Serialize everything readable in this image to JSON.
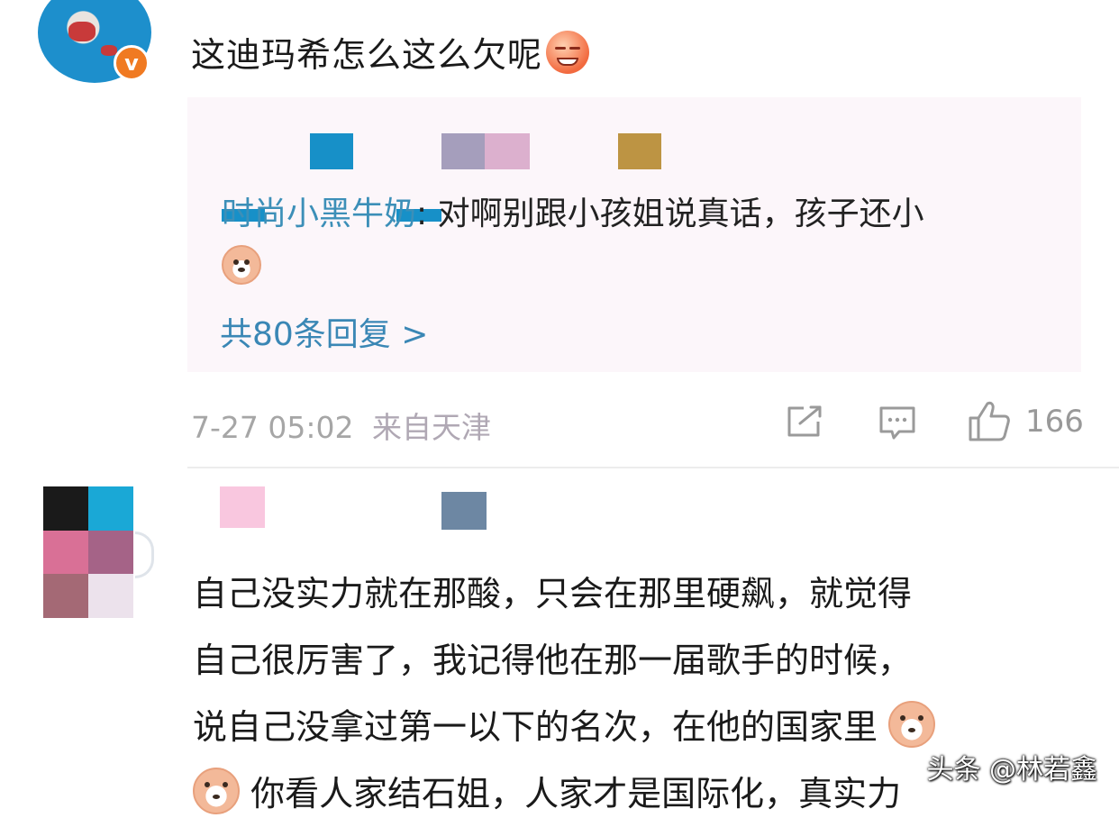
{
  "comment1": {
    "text": "这迪玛希怎么这么欠呢",
    "emoji": "dizzy-laugh-emoji",
    "reply": {
      "user": "时尚小黑牛奶",
      "separator": ": ",
      "text": "对啊别跟小孩姐说真话，孩子还小",
      "emoji": "doge-emoji"
    },
    "more_replies": "共80条回复 >",
    "time": "7-27 05:02",
    "location": "来自天津",
    "like_count": "166"
  },
  "comment2": {
    "lines": [
      "自己没实力就在那酸，只会在那里硬飙，就觉得",
      "自己很厉害了，我记得他在那一届歌手的时候，",
      "说自己没拿过第一以下的名次，在他的国家里",
      "你看人家结石姐，人家才是国际化，真实力"
    ],
    "emoji": "doge-emoji"
  },
  "watermark": "头条 @林若鑫",
  "colors": {
    "link_blue": "#3a87b5",
    "meta_gray": "#a6a6a6",
    "reply_bg": "#fcf6fa",
    "badge_orange": "#f07a22"
  }
}
